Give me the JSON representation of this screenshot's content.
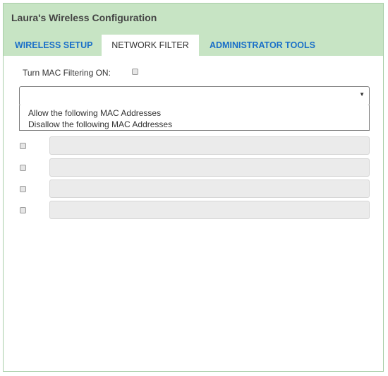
{
  "app": {
    "title": "Laura's Wireless Configuration"
  },
  "tabs": [
    {
      "label": "WIRELESS SETUP",
      "active": false
    },
    {
      "label": "NETWORK FILTER",
      "active": true
    },
    {
      "label": "ADMINISTRATOR TOOLS",
      "active": false
    }
  ],
  "mac_filter": {
    "label": "Turn MAC Filtering ON:",
    "checked": false,
    "mode_select": {
      "value": "",
      "expanded": true,
      "options": [
        "Allow the following MAC Addresses",
        "Disallow the following MAC Addresses"
      ]
    },
    "entries": [
      {
        "checked": false,
        "value": ""
      },
      {
        "checked": false,
        "value": ""
      },
      {
        "checked": false,
        "value": ""
      },
      {
        "checked": false,
        "value": ""
      }
    ]
  },
  "colors": {
    "header_bg": "#c7e4c4",
    "tab_link": "#1a6fc8",
    "border": "#a9cfa9"
  }
}
